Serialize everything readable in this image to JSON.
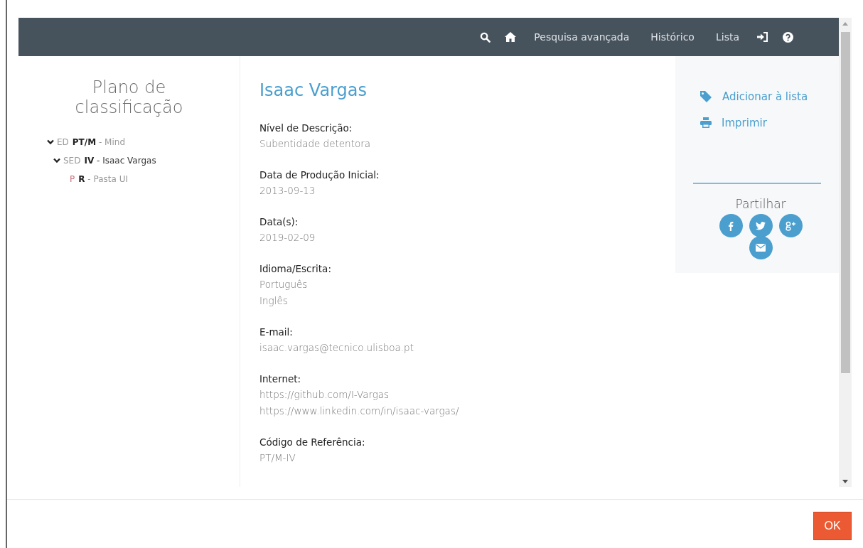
{
  "navbar": {
    "items": [
      {
        "kind": "search"
      },
      {
        "kind": "home"
      },
      {
        "kind": "text",
        "label": "Pesquisa avançada"
      },
      {
        "kind": "text",
        "label": "Histórico"
      },
      {
        "kind": "text",
        "label": "Lista"
      },
      {
        "kind": "login"
      },
      {
        "kind": "help"
      }
    ]
  },
  "sidebar": {
    "title": "Plano de classificação",
    "tree": [
      {
        "level": "ED",
        "color": "#9a9a9a",
        "label": "**PT/M** - Mind",
        "selected": false,
        "expanded": true,
        "children": [
          {
            "level": "SED",
            "color": "#9a9a9a",
            "label": "**IV** - Isaac Vargas",
            "selected": true,
            "expanded": true,
            "children": [
              {
                "level": "P",
                "color": "#c9747f",
                "label": "**R** - Pasta UI",
                "selected": false
              }
            ]
          }
        ]
      }
    ]
  },
  "record": {
    "title": "Isaac Vargas",
    "fields": [
      {
        "label": "Nível de Descrição:",
        "values": [
          "Subentidade detentora"
        ]
      },
      {
        "label": "Data de Produção Inicial:",
        "values": [
          "2013-09-13"
        ]
      },
      {
        "label": "Data(s):",
        "values": [
          "2019-02-09"
        ]
      },
      {
        "label": "Idioma/Escrita:",
        "values": [
          "Português",
          "Inglês"
        ]
      },
      {
        "label": "E-mail:",
        "values": [
          "isaac.vargas@tecnico.ulisboa.pt"
        ]
      },
      {
        "label": "Internet:",
        "values": [
          "https://github.com/I-Vargas",
          "https://www.linkedin.com/in/isaac-vargas/"
        ]
      },
      {
        "label": "Código de Referência:",
        "values": [
          "PT/M-IV"
        ]
      }
    ]
  },
  "actions": [
    {
      "kind": "tag",
      "label": "Adicionar à lista"
    },
    {
      "kind": "print",
      "label": "Imprimir"
    }
  ],
  "share": {
    "title": "Partilhar",
    "buttons": [
      {
        "kind": "facebook"
      },
      {
        "kind": "twitter"
      },
      {
        "kind": "googleplus"
      },
      {
        "kind": "email"
      }
    ]
  },
  "footer": {
    "button": "OK"
  }
}
